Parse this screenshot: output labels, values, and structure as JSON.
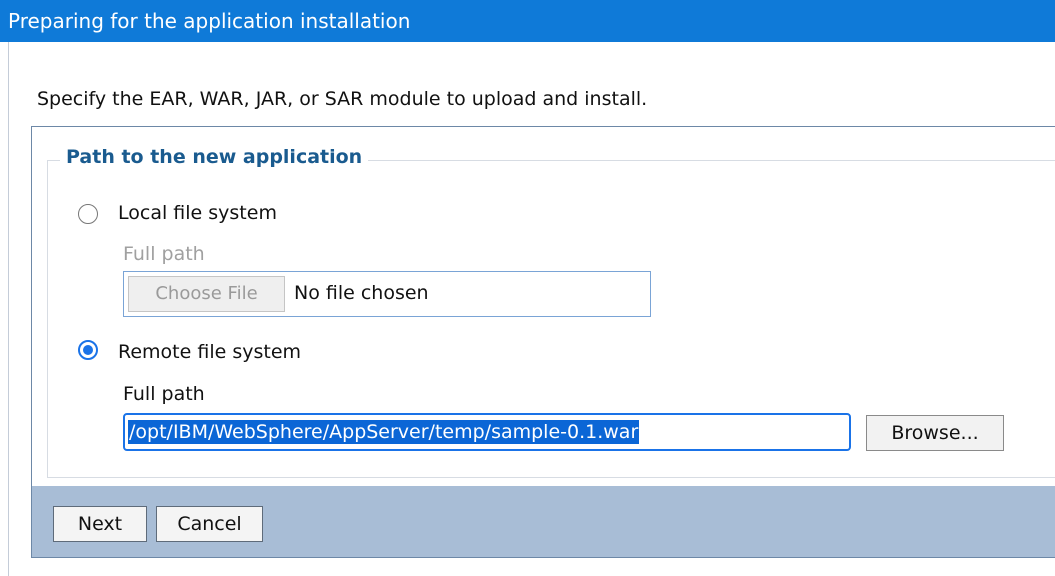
{
  "window": {
    "title": "Preparing for the application installation"
  },
  "instructions": "Specify the EAR, WAR, JAR, or SAR module to upload and install.",
  "path_group": {
    "legend": "Path to the new application",
    "local": {
      "label": "Local file system",
      "selected": false,
      "full_path_label": "Full path",
      "choose_file_label": "Choose File",
      "file_status": "No file chosen"
    },
    "remote": {
      "label": "Remote file system",
      "selected": true,
      "full_path_label": "Full path",
      "path_value": "/opt/IBM/WebSphere/AppServer/temp/sample-0.1.war",
      "browse_label": "Browse..."
    }
  },
  "actions": {
    "next_label": "Next",
    "cancel_label": "Cancel"
  },
  "colors": {
    "title_bar": "#0f7ad8",
    "legend_text": "#1a5b8f",
    "button_bar": "#a8bdd6",
    "selection": "#0b66d6"
  }
}
